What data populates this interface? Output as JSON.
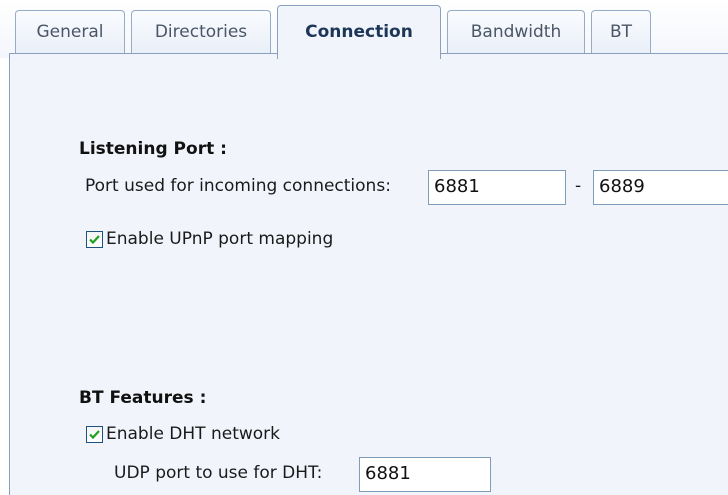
{
  "tabs": [
    {
      "label": "General",
      "active": false
    },
    {
      "label": "Directories",
      "active": false
    },
    {
      "label": "Connection",
      "active": true
    },
    {
      "label": "Bandwidth",
      "active": false
    },
    {
      "label": "BT",
      "active": false
    }
  ],
  "listening": {
    "heading": "Listening Port :",
    "port_label": "Port used for incoming connections:",
    "port_from": "6881",
    "separator": "-",
    "port_to": "6889",
    "upnp_label": "Enable UPnP port mapping",
    "upnp_checked": true
  },
  "bt_features": {
    "heading": "BT Features :",
    "dht_label": "Enable DHT network",
    "dht_checked": true,
    "udp_label": "UDP port to use for DHT:",
    "udp_port": "6881"
  },
  "colors": {
    "panel_bg": "#f1f5fb",
    "tab_border": "#8aa0c0",
    "checkmark": "#21a121"
  }
}
